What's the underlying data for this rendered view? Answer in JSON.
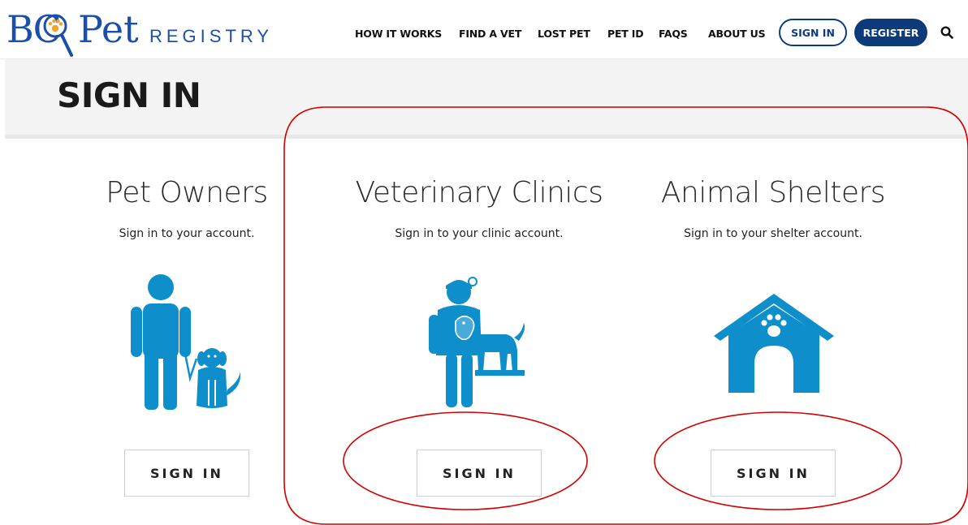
{
  "logo": {
    "part1": "BC",
    "part2": "Pet",
    "part3": "REGISTRY"
  },
  "nav": {
    "items": [
      {
        "label": "HOW IT WORKS"
      },
      {
        "label": "FIND A VET"
      },
      {
        "label": "LOST PET"
      },
      {
        "label": "PET ID"
      },
      {
        "label": "FAQS"
      },
      {
        "label": "ABOUT US"
      }
    ],
    "sign_in": "SIGN IN",
    "register": "REGISTER"
  },
  "page": {
    "title": "SIGN IN"
  },
  "sections": [
    {
      "heading": "Pet Owners",
      "subtitle": "Sign in to your account.",
      "button": "SIGN IN",
      "icon": "pet-owner-with-dog-icon"
    },
    {
      "heading": "Veterinary Clinics",
      "subtitle": "Sign in to your clinic account.",
      "button": "SIGN IN",
      "icon": "veterinarian-with-dog-icon"
    },
    {
      "heading": "Animal Shelters",
      "subtitle": "Sign in to your shelter account.",
      "button": "SIGN IN",
      "icon": "dog-house-icon"
    }
  ],
  "colors": {
    "brand_blue": "#1b4fa8",
    "nav_dark_blue": "#0d3b7a",
    "icon_blue": "#0e8fcb",
    "paw_orange": "#f0a42a",
    "annotation_red": "#d40000"
  }
}
